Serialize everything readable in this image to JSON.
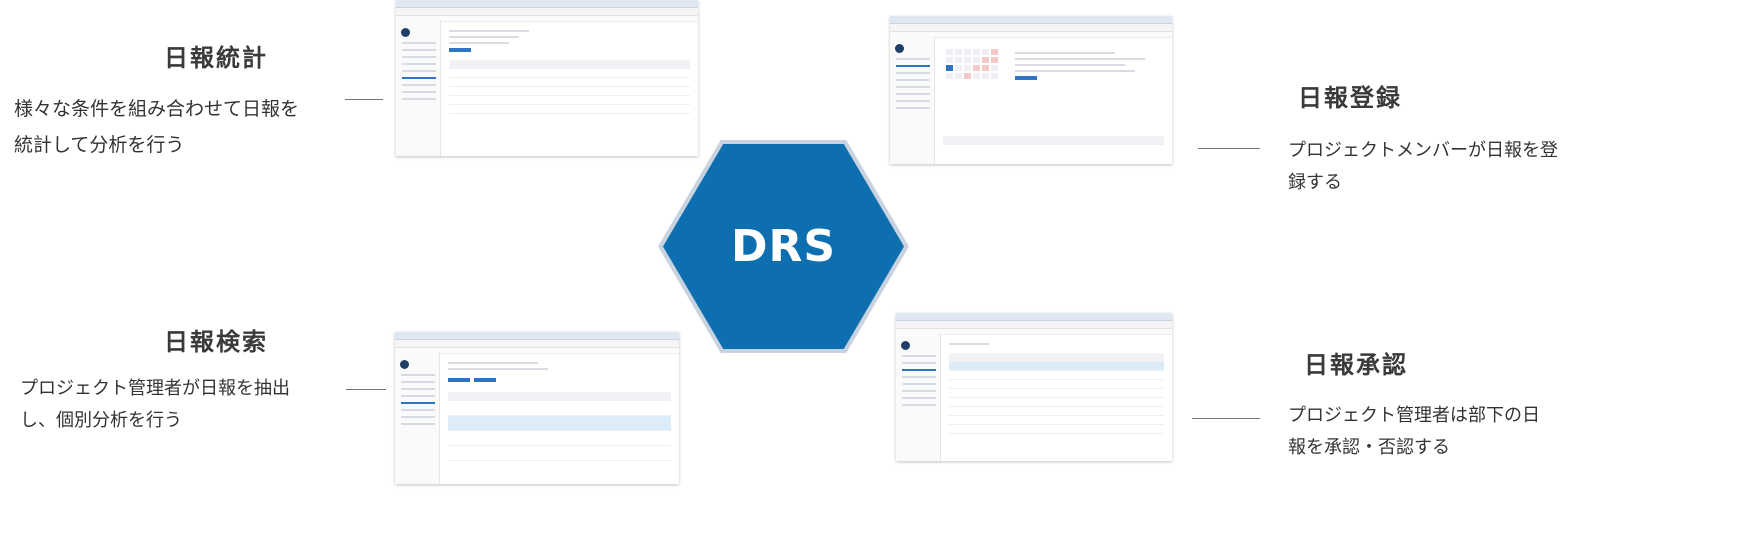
{
  "center": {
    "label": "DRS",
    "color": "#0e6fb0"
  },
  "features": {
    "statistics": {
      "title": "日報統計",
      "desc_line1": "様々な条件を組み合わせて日報を",
      "desc_line2": "統計して分析を行う"
    },
    "registration": {
      "title": "日報登録",
      "desc_line1": "プロジェクトメンバーが日報を登",
      "desc_line2": "録する"
    },
    "search": {
      "title": "日報検索",
      "desc_line1": "プロジェクト管理者が日報を抽出",
      "desc_line2": "し、個別分析を行う"
    },
    "approval": {
      "title": "日報承認",
      "desc_line1": "プロジェクト管理者は部下の日",
      "desc_line2": "報を承認・否認する"
    }
  }
}
